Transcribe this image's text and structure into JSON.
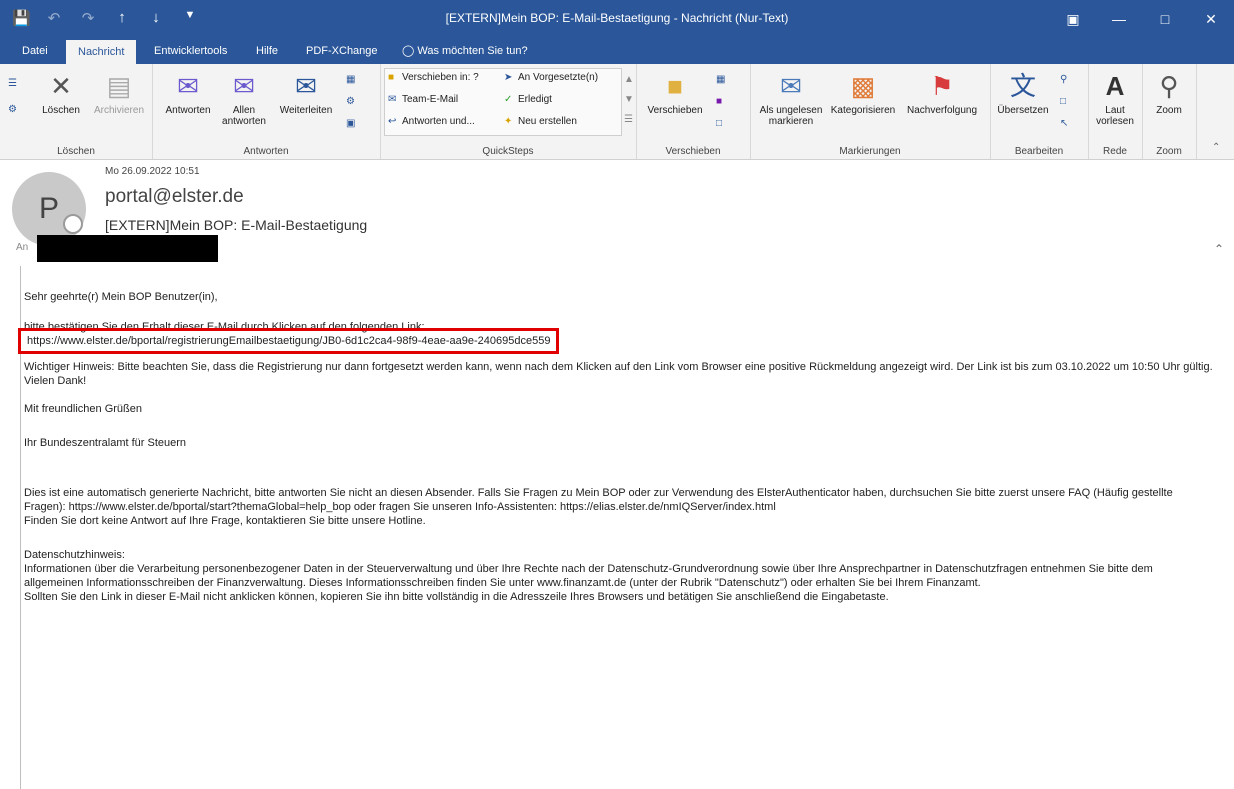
{
  "titlebar": {
    "title": "[EXTERN]Mein BOP: E-Mail-Bestaetigung  -  Nachricht (Nur-Text)",
    "icons": [
      "save-icon",
      "undo-icon",
      "redo-icon",
      "up-arrow-icon",
      "down-arrow-icon",
      "customize-icon"
    ],
    "controls": [
      "ribbon-display-icon",
      "minimize-icon",
      "maximize-icon",
      "close-icon"
    ]
  },
  "tabs": [
    {
      "label": "Datei"
    },
    {
      "label": "Nachricht"
    },
    {
      "label": "Entwicklertools"
    },
    {
      "label": "Hilfe"
    },
    {
      "label": "PDF-XChange"
    },
    {
      "label": "Was möchten Sie tun?"
    }
  ],
  "ribbon": {
    "groups": {
      "loeschen": "Löschen",
      "antworten": "Antworten",
      "quicksteps": "QuickSteps",
      "verschieben": "Verschieben",
      "markierungen": "Markierungen",
      "bearbeiten": "Bearbeiten",
      "rede": "Rede",
      "zoom": "Zoom"
    },
    "buttons": {
      "loeschen": "Löschen",
      "archivieren": "Archivieren",
      "antworten": "Antworten",
      "allen_antworten": "Allen antworten",
      "weiterleiten": "Weiterleiten",
      "verschieben": "Verschieben",
      "ungelesen": "Als ungelesen markieren",
      "kategorisieren": "Kategorisieren",
      "nachverfolgung": "Nachverfolgung",
      "uebersetzen": "Übersetzen",
      "laut_vorlesen": "Laut vorlesen",
      "zoom": "Zoom"
    },
    "quicksteps": {
      "verschieben_in": "Verschieben in: ?",
      "team_email": "Team-E-Mail",
      "antworten_und": "Antworten und...",
      "an_vorgesetzte": "An Vorgesetzte(n)",
      "erledigt": "Erledigt",
      "neu_erstellen": "Neu erstellen"
    }
  },
  "header": {
    "avatar_initial": "P",
    "date": "Mo 26.09.2022 10:51",
    "sender": "portal@elster.de",
    "subject": "[EXTERN]Mein BOP: E-Mail-Bestaetigung",
    "to_label": "An"
  },
  "body": {
    "greeting": "Sehr geehrte(r) Mein BOP Benutzer(in),",
    "instruction": "bitte bestätigen Sie den Erhalt dieser E-Mail durch Klicken auf den folgenden Link:",
    "link": "https://www.elster.de/bportal/registrierungEmailbestaetigung/JB0-6d1c2ca4-98f9-4eae-aa9e-240695dce559",
    "hint": "Wichtiger Hinweis: Bitte beachten Sie, dass die Registrierung nur dann fortgesetzt werden kann, wenn nach dem Klicken auf den Link vom Browser eine positive Rückmeldung angezeigt wird. Der Link ist bis zum 03.10.2022 um 10:50 Uhr gültig.",
    "thanks": "Vielen Dank!",
    "regards": "Mit freundlichen Grüßen",
    "signature": "Ihr Bundeszentralamt für Steuern",
    "auto_notice": "Dies ist eine automatisch generierte Nachricht, bitte antworten Sie nicht an diesen Absender. Falls Sie Fragen zu Mein BOP oder zur Verwendung des ElsterAuthenticator haben, durchsuchen Sie bitte zuerst unsere FAQ (Häufig gestellte Fragen): https://www.elster.de/bportal/start?themaGlobal=help_bop oder fragen Sie unseren Info-Assistenten: https://elias.elster.de/nmIQServer/index.html",
    "hotline": "Finden Sie dort keine Antwort auf Ihre Frage, kontaktieren Sie bitte unsere Hotline.",
    "privacy_title": "Datenschutzhinweis:",
    "privacy_text": "Informationen über die Verarbeitung personenbezogener Daten in der Steuerverwaltung und über Ihre Rechte nach der Datenschutz-Grundverordnung sowie über Ihre Ansprechpartner in Datenschutzfragen entnehmen Sie bitte dem allgemeinen Informationsschreiben der Finanzverwaltung. Dieses Informationsschreiben finden Sie unter www.finanzamt.de (unter der Rubrik \"Datenschutz\") oder erhalten Sie bei Ihrem Finanzamt.",
    "copy_hint": "Sollten Sie den Link in dieser E-Mail nicht anklicken können, kopieren Sie ihn bitte vollständig in die Adresszeile Ihres Browsers und betätigen Sie anschließend die Eingabetaste."
  },
  "colors": {
    "accent": "#2b579a",
    "highlight_box": "#e00000"
  }
}
